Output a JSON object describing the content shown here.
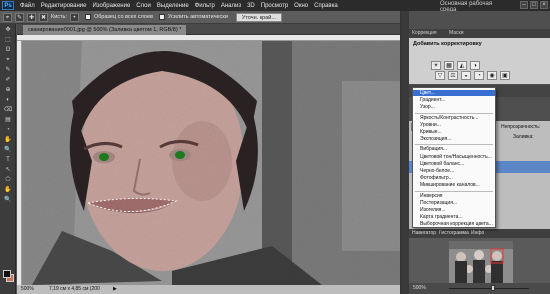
{
  "app": {
    "logo": "Ps",
    "menu": [
      "Файл",
      "Редактирование",
      "Изображение",
      "Слои",
      "Выделение",
      "Фильтр",
      "Анализ",
      "3D",
      "Просмотр",
      "Окно",
      "Справка"
    ],
    "workspace": "Основная рабочая среда",
    "window_controls": [
      "–",
      "□",
      "×"
    ]
  },
  "options": {
    "brush_label": "Кисть:",
    "sample_all": "Образец со всех слоев",
    "auto_enhance": "Усилить автоматически",
    "refine_button": "Уточн. край..."
  },
  "tools": [
    "✥",
    "⬚",
    "ʘ",
    "⌖",
    "✎",
    "✐",
    "⊕",
    "◐",
    "⌫",
    "▤",
    "◔",
    "✋",
    "🔍",
    "T",
    "↖",
    "⬠",
    "✋",
    "🔍"
  ],
  "document": {
    "tab": "сканирование0001.jpg @ 500% (Заливка цветом 1, RGB/8) *",
    "zoom": "500%",
    "doc_info": "7,19 см x 4,85 см (200 ppi)"
  },
  "panels": {
    "tab_left": "Коррекция",
    "tab_right": "Маски",
    "adj_title": "Добавить корректировку",
    "adj_icons_row1": [
      "☀",
      "▦",
      "◭",
      "◑"
    ],
    "adj_icons_row2": [
      "▽",
      "⚖",
      "◒",
      "◔",
      "◉",
      "▣"
    ],
    "layers_tab": "Слои",
    "opacity_label": "Непрозрачность:",
    "fill_label": "Заливка:"
  },
  "menu": {
    "items": [
      "Цвет...",
      "Градиент...",
      "Узор...",
      "Яркость/Контрастность...",
      "Уровни...",
      "Кривые...",
      "Экспозиция...",
      "Вибрация...",
      "Цветовой тон/Насыщенность...",
      "Цветовой баланс...",
      "Черно-белое...",
      "Фотофильтр...",
      "Микширование каналов...",
      "Инверсия",
      "Постеризация...",
      "Изогелия...",
      "Карта градиента...",
      "Выборочная коррекция цвета..."
    ],
    "highlighted_index": 0
  },
  "navigator": {
    "tabs": [
      "Навигатор",
      "Гистограмма",
      "Инфо"
    ],
    "zoom": "500%",
    "zoom_fraction": 0.55
  },
  "colors": {
    "accent": "#3a6fd2",
    "layer_selected": "#5b86c6",
    "eye_tint": "#1f7a1f",
    "foreground": "#111111",
    "background": "#c9735b"
  }
}
